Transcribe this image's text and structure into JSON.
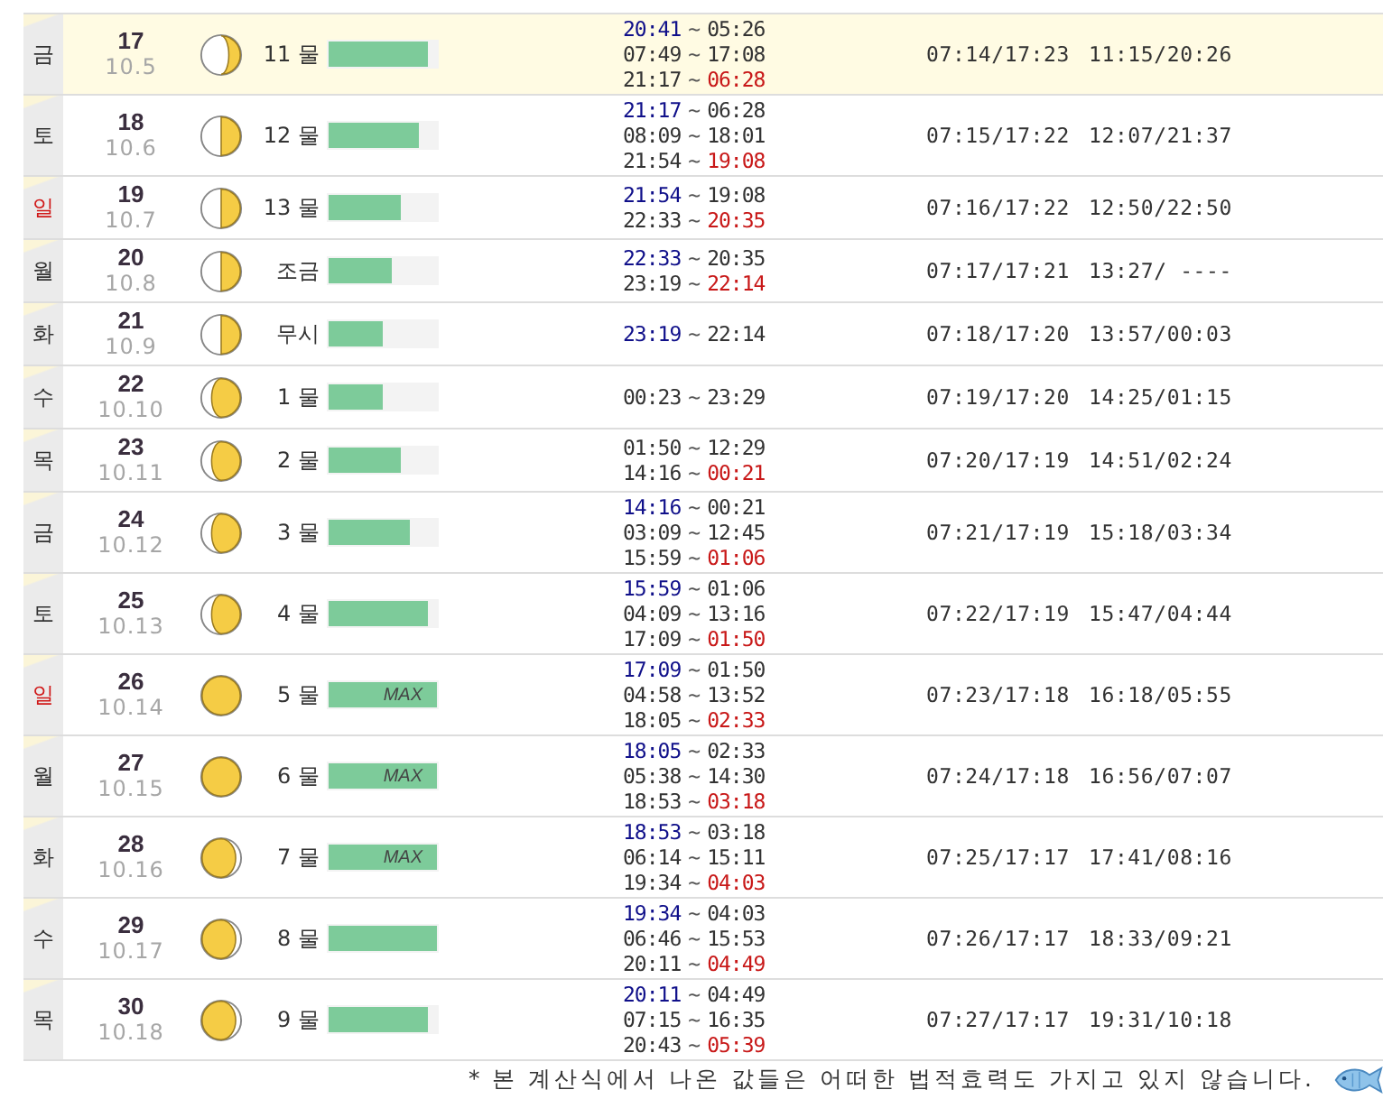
{
  "rows": [
    {
      "weekday": "금",
      "holiday": false,
      "today": true,
      "day": "17",
      "lunar": "10.5",
      "moon": {
        "kind": "crescent"
      },
      "tide": {
        "label": "11 물",
        "level": 0.92
      },
      "times": [
        {
          "start": "20:41",
          "sep": "~",
          "end": "05:26",
          "carry_over": true,
          "next_day": false
        },
        {
          "start": "07:49",
          "sep": "~",
          "end": "17:08",
          "carry_over": false,
          "next_day": false
        },
        {
          "start": "21:17",
          "sep": "~",
          "end": "06:28",
          "carry_over": false,
          "next_day": true
        }
      ],
      "sun": "07:14/17:23",
      "moonrise": "11:15/20:26"
    },
    {
      "weekday": "토",
      "holiday": false,
      "today": false,
      "day": "18",
      "lunar": "10.6",
      "moon": {
        "kind": "half"
      },
      "tide": {
        "label": "12 물",
        "level": 0.83
      },
      "times": [
        {
          "start": "21:17",
          "sep": "~",
          "end": "06:28",
          "carry_over": true,
          "next_day": false
        },
        {
          "start": "08:09",
          "sep": "~",
          "end": "18:01",
          "carry_over": false,
          "next_day": false
        },
        {
          "start": "21:54",
          "sep": "~",
          "end": "19:08",
          "carry_over": false,
          "next_day": true
        }
      ],
      "sun": "07:15/17:22",
      "moonrise": "12:07/21:37"
    },
    {
      "weekday": "일",
      "holiday": true,
      "today": false,
      "day": "19",
      "lunar": "10.7",
      "moon": {
        "kind": "half"
      },
      "tide": {
        "label": "13 물",
        "level": 0.67
      },
      "times": [
        {
          "start": "21:54",
          "sep": "~",
          "end": "19:08",
          "carry_over": true,
          "next_day": false
        },
        {
          "start": "22:33",
          "sep": "~",
          "end": "20:35",
          "carry_over": false,
          "next_day": true
        }
      ],
      "sun": "07:16/17:22",
      "moonrise": "12:50/22:50"
    },
    {
      "weekday": "월",
      "holiday": false,
      "today": false,
      "day": "20",
      "lunar": "10.8",
      "moon": {
        "kind": "half"
      },
      "tide": {
        "label": "조금",
        "level": 0.58
      },
      "times": [
        {
          "start": "22:33",
          "sep": "~",
          "end": "20:35",
          "carry_over": true,
          "next_day": false
        },
        {
          "start": "23:19",
          "sep": "~",
          "end": "22:14",
          "carry_over": false,
          "next_day": true
        }
      ],
      "sun": "07:17/17:21",
      "moonrise": "13:27/ ----"
    },
    {
      "weekday": "화",
      "holiday": false,
      "today": false,
      "day": "21",
      "lunar": "10.9",
      "moon": {
        "kind": "half"
      },
      "tide": {
        "label": "무시",
        "level": 0.5
      },
      "times": [
        {
          "start": "23:19",
          "sep": "~",
          "end": "22:14",
          "carry_over": true,
          "next_day": false
        }
      ],
      "sun": "07:18/17:20",
      "moonrise": "13:57/00:03"
    },
    {
      "weekday": "수",
      "holiday": false,
      "today": false,
      "day": "22",
      "lunar": "10.10",
      "moon": {
        "kind": "gibbous"
      },
      "tide": {
        "label": "1 물",
        "level": 0.5
      },
      "times": [
        {
          "start": "00:23",
          "sep": "~",
          "end": "23:29",
          "carry_over": false,
          "next_day": false
        }
      ],
      "sun": "07:19/17:20",
      "moonrise": "14:25/01:15"
    },
    {
      "weekday": "목",
      "holiday": false,
      "today": false,
      "day": "23",
      "lunar": "10.11",
      "moon": {
        "kind": "gibbous"
      },
      "tide": {
        "label": "2 물",
        "level": 0.67
      },
      "times": [
        {
          "start": "01:50",
          "sep": "~",
          "end": "12:29",
          "carry_over": false,
          "next_day": false
        },
        {
          "start": "14:16",
          "sep": "~",
          "end": "00:21",
          "carry_over": false,
          "next_day": true
        }
      ],
      "sun": "07:20/17:19",
      "moonrise": "14:51/02:24"
    },
    {
      "weekday": "금",
      "holiday": false,
      "today": false,
      "day": "24",
      "lunar": "10.12",
      "moon": {
        "kind": "gibbous"
      },
      "tide": {
        "label": "3 물",
        "level": 0.75
      },
      "times": [
        {
          "start": "14:16",
          "sep": "~",
          "end": "00:21",
          "carry_over": true,
          "next_day": false
        },
        {
          "start": "03:09",
          "sep": "~",
          "end": "12:45",
          "carry_over": false,
          "next_day": false
        },
        {
          "start": "15:59",
          "sep": "~",
          "end": "01:06",
          "carry_over": false,
          "next_day": true
        }
      ],
      "sun": "07:21/17:19",
      "moonrise": "15:18/03:34"
    },
    {
      "weekday": "토",
      "holiday": false,
      "today": false,
      "day": "25",
      "lunar": "10.13",
      "moon": {
        "kind": "gibbous"
      },
      "tide": {
        "label": "4 물",
        "level": 0.92
      },
      "times": [
        {
          "start": "15:59",
          "sep": "~",
          "end": "01:06",
          "carry_over": true,
          "next_day": false
        },
        {
          "start": "04:09",
          "sep": "~",
          "end": "13:16",
          "carry_over": false,
          "next_day": false
        },
        {
          "start": "17:09",
          "sep": "~",
          "end": "01:50",
          "carry_over": false,
          "next_day": true
        }
      ],
      "sun": "07:22/17:19",
      "moonrise": "15:47/04:44"
    },
    {
      "weekday": "일",
      "holiday": true,
      "today": false,
      "day": "26",
      "lunar": "10.14",
      "moon": {
        "kind": "full"
      },
      "tide": {
        "label": "5 물",
        "level": 1,
        "max_label": "MAX"
      },
      "times": [
        {
          "start": "17:09",
          "sep": "~",
          "end": "01:50",
          "carry_over": true,
          "next_day": false
        },
        {
          "start": "04:58",
          "sep": "~",
          "end": "13:52",
          "carry_over": false,
          "next_day": false
        },
        {
          "start": "18:05",
          "sep": "~",
          "end": "02:33",
          "carry_over": false,
          "next_day": true
        }
      ],
      "sun": "07:23/17:18",
      "moonrise": "16:18/05:55"
    },
    {
      "weekday": "월",
      "holiday": false,
      "today": false,
      "day": "27",
      "lunar": "10.15",
      "moon": {
        "kind": "full"
      },
      "tide": {
        "label": "6 물",
        "level": 1,
        "max_label": "MAX"
      },
      "times": [
        {
          "start": "18:05",
          "sep": "~",
          "end": "02:33",
          "carry_over": true,
          "next_day": false
        },
        {
          "start": "05:38",
          "sep": "~",
          "end": "14:30",
          "carry_over": false,
          "next_day": false
        },
        {
          "start": "18:53",
          "sep": "~",
          "end": "03:18",
          "carry_over": false,
          "next_day": true
        }
      ],
      "sun": "07:24/17:18",
      "moonrise": "16:56/07:07"
    },
    {
      "weekday": "화",
      "holiday": false,
      "today": false,
      "day": "28",
      "lunar": "10.16",
      "moon": {
        "kind": "waning"
      },
      "tide": {
        "label": "7 물",
        "level": 1,
        "max_label": "MAX"
      },
      "times": [
        {
          "start": "18:53",
          "sep": "~",
          "end": "03:18",
          "carry_over": true,
          "next_day": false
        },
        {
          "start": "06:14",
          "sep": "~",
          "end": "15:11",
          "carry_over": false,
          "next_day": false
        },
        {
          "start": "19:34",
          "sep": "~",
          "end": "04:03",
          "carry_over": false,
          "next_day": true
        }
      ],
      "sun": "07:25/17:17",
      "moonrise": "17:41/08:16"
    },
    {
      "weekday": "수",
      "holiday": false,
      "today": false,
      "day": "29",
      "lunar": "10.17",
      "moon": {
        "kind": "waning"
      },
      "tide": {
        "label": "8 물",
        "level": 1
      },
      "times": [
        {
          "start": "19:34",
          "sep": "~",
          "end": "04:03",
          "carry_over": true,
          "next_day": false
        },
        {
          "start": "06:46",
          "sep": "~",
          "end": "15:53",
          "carry_over": false,
          "next_day": false
        },
        {
          "start": "20:11",
          "sep": "~",
          "end": "04:49",
          "carry_over": false,
          "next_day": true
        }
      ],
      "sun": "07:26/17:17",
      "moonrise": "18:33/09:21"
    },
    {
      "weekday": "목",
      "holiday": false,
      "today": false,
      "day": "30",
      "lunar": "10.18",
      "moon": {
        "kind": "waning"
      },
      "tide": {
        "label": "9 물",
        "level": 0.92
      },
      "times": [
        {
          "start": "20:11",
          "sep": "~",
          "end": "04:49",
          "carry_over": true,
          "next_day": false
        },
        {
          "start": "07:15",
          "sep": "~",
          "end": "16:35",
          "carry_over": false,
          "next_day": false
        },
        {
          "start": "20:43",
          "sep": "~",
          "end": "05:39",
          "carry_over": false,
          "next_day": true
        }
      ],
      "sun": "07:27/17:17",
      "moonrise": "19:31/10:18"
    }
  ],
  "footnote": "* 본 계산식에서 나온 값들은 어떠한 법적효력도 가지고 있지 않습니다."
}
